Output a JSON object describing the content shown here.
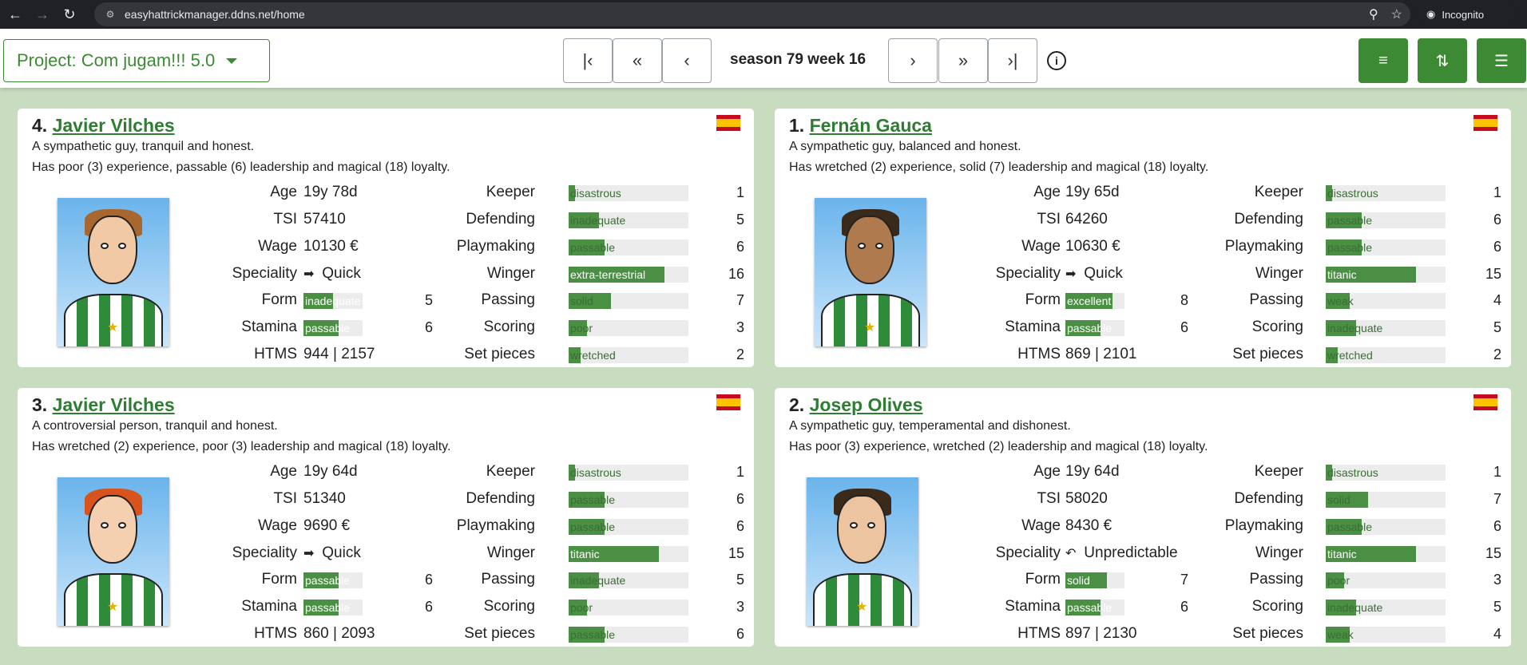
{
  "browser": {
    "url": "easyhattrickmanager.ddns.net/home",
    "profile_label": "Incognito"
  },
  "header": {
    "project_label": "Project: Com jugam!!! 5.0",
    "season_label": "season 79 week 16"
  },
  "colors": {
    "accent": "#3c8a33",
    "bar_fill": "#4a8f43"
  },
  "labels": {
    "age": "Age",
    "tsi": "TSI",
    "wage": "Wage",
    "speciality": "Speciality",
    "form": "Form",
    "stamina": "Stamina",
    "htms": "HTMS",
    "keeper": "Keeper",
    "defending": "Defending",
    "playmaking": "Playmaking",
    "winger": "Winger",
    "passing": "Passing",
    "scoring": "Scoring",
    "set_pieces": "Set pieces"
  },
  "players": [
    {
      "rank": "4.",
      "name": "Javier Vilches",
      "flag": "spain-flag",
      "desc1": "A sympathetic guy, tranquil and honest.",
      "desc2": "Has poor (3) experience, passable (6) leadership and magical (18) loyalty.",
      "age": "19y 78d",
      "tsi": "57410",
      "wage": "10130 €",
      "speciality": "Quick",
      "speciality_icon": "quick-icon",
      "form": {
        "word": "inadequate",
        "num": "5"
      },
      "stamina": {
        "word": "passable",
        "num": "6"
      },
      "htms": "944 | 2157",
      "skills": [
        {
          "word": "disastrous",
          "num": "1"
        },
        {
          "word": "inadequate",
          "num": "5"
        },
        {
          "word": "passable",
          "num": "6"
        },
        {
          "word": "extra-terrestrial",
          "num": "16"
        },
        {
          "word": "solid",
          "num": "7"
        },
        {
          "word": "poor",
          "num": "3"
        },
        {
          "word": "wretched",
          "num": "2"
        }
      ]
    },
    {
      "rank": "1.",
      "name": "Fernán Gauca",
      "flag": "spain-flag",
      "desc1": "A sympathetic guy, balanced and honest.",
      "desc2": "Has wretched (2) experience, solid (7) leadership and magical (18) loyalty.",
      "age": "19y 65d",
      "tsi": "64260",
      "wage": "10630 €",
      "speciality": "Quick",
      "speciality_icon": "quick-icon",
      "form": {
        "word": "excellent",
        "num": "8"
      },
      "stamina": {
        "word": "passable",
        "num": "6"
      },
      "htms": "869 | 2101",
      "skills": [
        {
          "word": "disastrous",
          "num": "1"
        },
        {
          "word": "passable",
          "num": "6"
        },
        {
          "word": "passable",
          "num": "6"
        },
        {
          "word": "titanic",
          "num": "15"
        },
        {
          "word": "weak",
          "num": "4"
        },
        {
          "word": "inadequate",
          "num": "5"
        },
        {
          "word": "wretched",
          "num": "2"
        }
      ]
    },
    {
      "rank": "3.",
      "name": "Javier Vilches",
      "flag": "spain-flag",
      "desc1": "A controversial person, tranquil and honest.",
      "desc2": "Has wretched (2) experience, poor (3) leadership and magical (18) loyalty.",
      "age": "19y 64d",
      "tsi": "51340",
      "wage": "9690 €",
      "speciality": "Quick",
      "speciality_icon": "quick-icon",
      "form": {
        "word": "passable",
        "num": "6"
      },
      "stamina": {
        "word": "passable",
        "num": "6"
      },
      "htms": "860 | 2093",
      "skills": [
        {
          "word": "disastrous",
          "num": "1"
        },
        {
          "word": "passable",
          "num": "6"
        },
        {
          "word": "passable",
          "num": "6"
        },
        {
          "word": "titanic",
          "num": "15"
        },
        {
          "word": "inadequate",
          "num": "5"
        },
        {
          "word": "poor",
          "num": "3"
        },
        {
          "word": "passable",
          "num": "6"
        }
      ]
    },
    {
      "rank": "2.",
      "name": "Josep Olives",
      "flag": "spain-flag",
      "desc1": "A sympathetic guy, temperamental and dishonest.",
      "desc2": "Has poor (3) experience, wretched (2) leadership and magical (18) loyalty.",
      "age": "19y 64d",
      "tsi": "58020",
      "wage": "8430 €",
      "speciality": "Unpredictable",
      "speciality_icon": "unpredictable-icon",
      "form": {
        "word": "solid",
        "num": "7"
      },
      "stamina": {
        "word": "passable",
        "num": "6"
      },
      "htms": "897 | 2130",
      "skills": [
        {
          "word": "disastrous",
          "num": "1"
        },
        {
          "word": "solid",
          "num": "7"
        },
        {
          "word": "passable",
          "num": "6"
        },
        {
          "word": "titanic",
          "num": "15"
        },
        {
          "word": "poor",
          "num": "3"
        },
        {
          "word": "inadequate",
          "num": "5"
        },
        {
          "word": "weak",
          "num": "4"
        }
      ]
    }
  ]
}
